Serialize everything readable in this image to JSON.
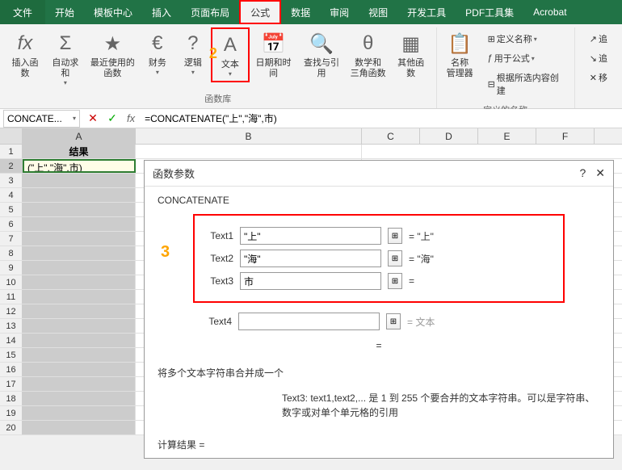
{
  "tabs": {
    "file": "文件",
    "home": "开始",
    "template": "模板中心",
    "insert": "插入",
    "pageLayout": "页面布局",
    "formulas": "公式",
    "data": "数据",
    "review": "审阅",
    "view": "视图",
    "developer": "开发工具",
    "pdf": "PDF工具集",
    "acrobat": "Acrobat"
  },
  "ribbon": {
    "insertFn": "插入函数",
    "autoSum": "自动求和",
    "recentFn": "最近使用的\n函数",
    "financial": "财务",
    "logical": "逻辑",
    "text": "文本",
    "dateTime": "日期和时间",
    "lookup": "查找与引用",
    "math": "数学和\n三角函数",
    "moreFn": "其他函数",
    "groupFnLib": "函数库",
    "nameMgr": "名称\n管理器",
    "defineName": "定义名称",
    "useInFormula": "用于公式",
    "createFromSel": "根据所选内容创建",
    "groupDefNames": "定义的名称",
    "trace": "追",
    "traceDep": "追",
    "move": "移"
  },
  "nameBox": "CONCATE...",
  "formula": "=CONCATENATE(\"上\",\"海\",市)",
  "columns": {
    "a": "A",
    "b": "B",
    "c": "C",
    "d": "D",
    "e": "E",
    "f": "F"
  },
  "cells": {
    "a1": "结果",
    "a2": "(\"上\",\"海\",市)"
  },
  "rows": [
    "1",
    "2",
    "3",
    "4",
    "5",
    "6",
    "7",
    "8",
    "9",
    "10",
    "11",
    "12",
    "13",
    "14",
    "15",
    "16",
    "17",
    "18",
    "19",
    "20"
  ],
  "dialog": {
    "title": "函数参数",
    "help": "?",
    "close": "✕",
    "funcName": "CONCATENATE",
    "args": [
      {
        "label": "Text1",
        "value": "\"上\"",
        "result": "= \"上\""
      },
      {
        "label": "Text2",
        "value": "\"海\"",
        "result": "= \"海\""
      },
      {
        "label": "Text3",
        "value": "市",
        "result": "="
      },
      {
        "label": "Text4",
        "value": "",
        "result": "= 文本"
      }
    ],
    "eq": "=",
    "desc": "将多个文本字符串合并成一个",
    "hint": "Text3:  text1,text2,... 是 1 到 255 个要合并的文本字符串。可以是字符串、数字或对单个单元格的引用",
    "footer": "计算结果 ="
  },
  "callouts": {
    "c2": "2",
    "c3": "3"
  }
}
